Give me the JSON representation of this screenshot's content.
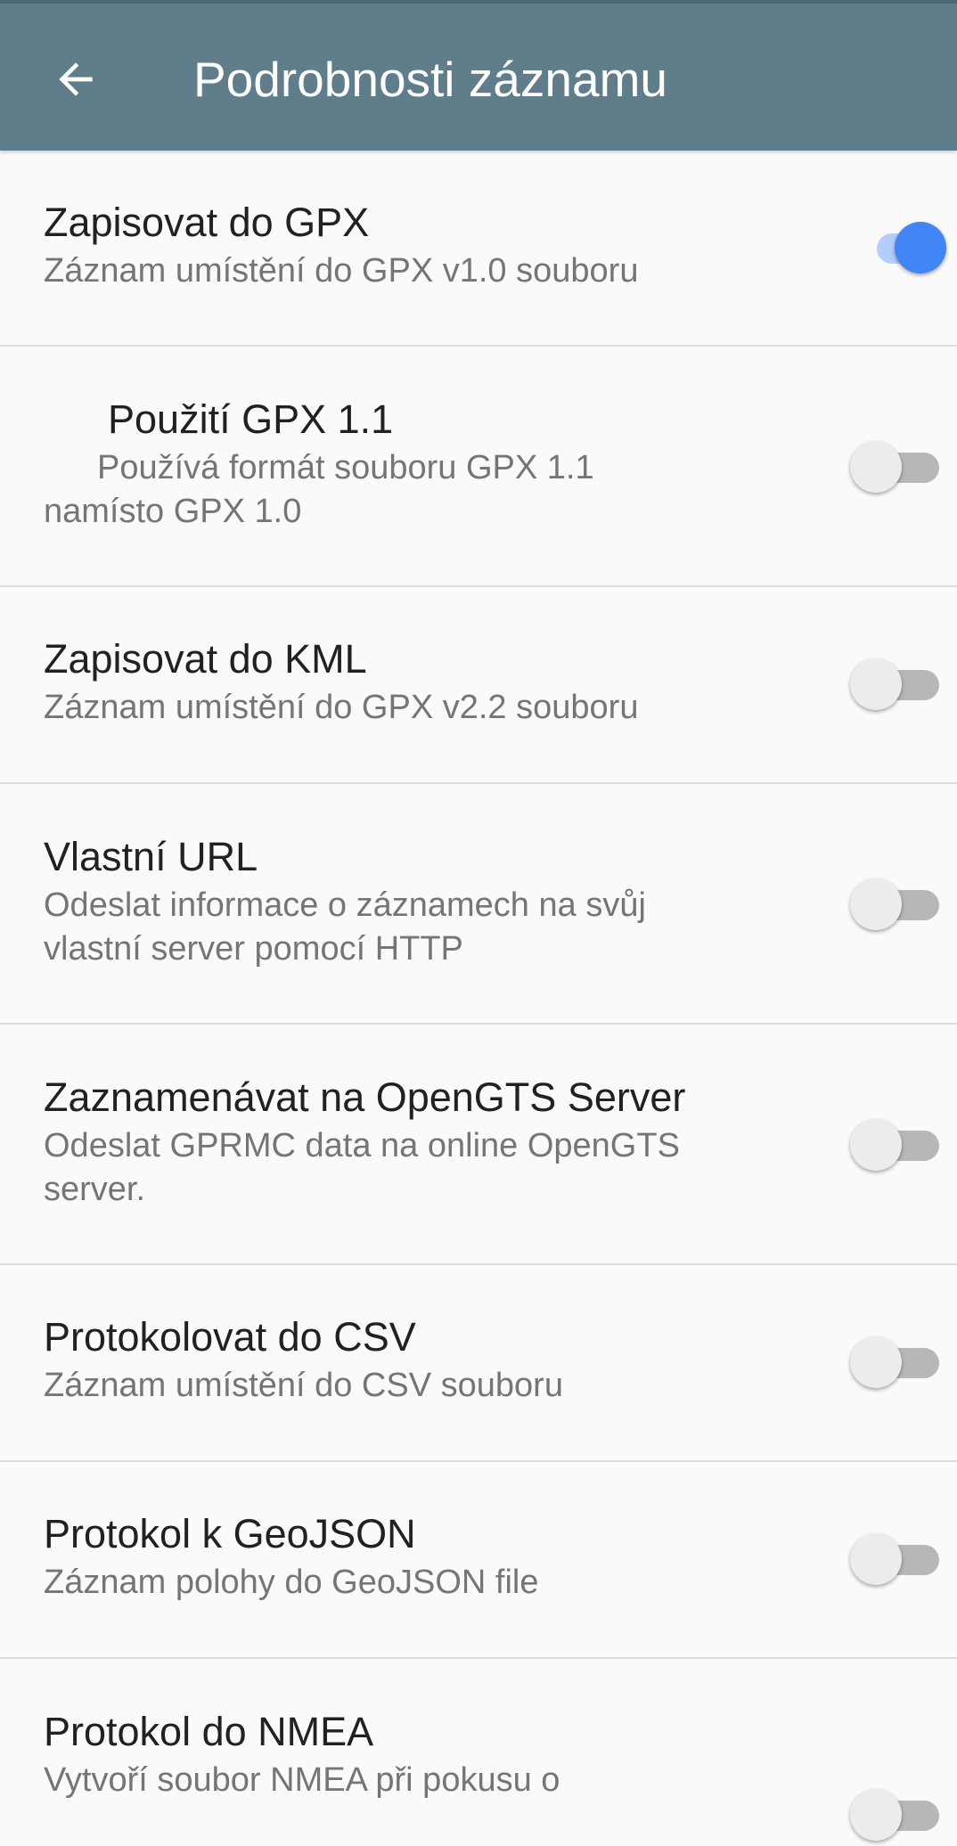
{
  "app_bar": {
    "title": "Podrobnosti záznamu",
    "back_icon": "arrow-left-icon",
    "background_color": "#607d8b"
  },
  "accent_color": "#4285f4",
  "preferences": [
    {
      "title": "Zapisovat do GPX",
      "summary": "Záznam umístění do GPX v1.0 souboru",
      "enabled": true
    },
    {
      "title": "Použití GPX 1.1",
      "summary_line1": "Používá formát souboru GPX 1.1",
      "summary_line2": "namísto GPX 1.0",
      "enabled": false
    },
    {
      "title": "Zapisovat do KML",
      "summary": "Záznam umístění do GPX v2.2 souboru",
      "enabled": false
    },
    {
      "title": "Vlastní URL",
      "summary": "Odeslat informace o záznamech na svůj vlastní server pomocí HTTP",
      "enabled": false
    },
    {
      "title": "Zaznamenávat na OpenGTS Server",
      "summary": "Odeslat GPRMC data na online OpenGTS server.",
      "enabled": false
    },
    {
      "title": "Protokolovat do CSV",
      "summary": "Záznam umístění do CSV souboru",
      "enabled": false
    },
    {
      "title": "Protokol k GeoJSON",
      "summary": "Záznam polohy do GeoJSON file",
      "enabled": false
    },
    {
      "title": "Protokol do NMEA",
      "summary": "Vytvoří soubor NMEA při pokusu o",
      "enabled": false
    }
  ]
}
